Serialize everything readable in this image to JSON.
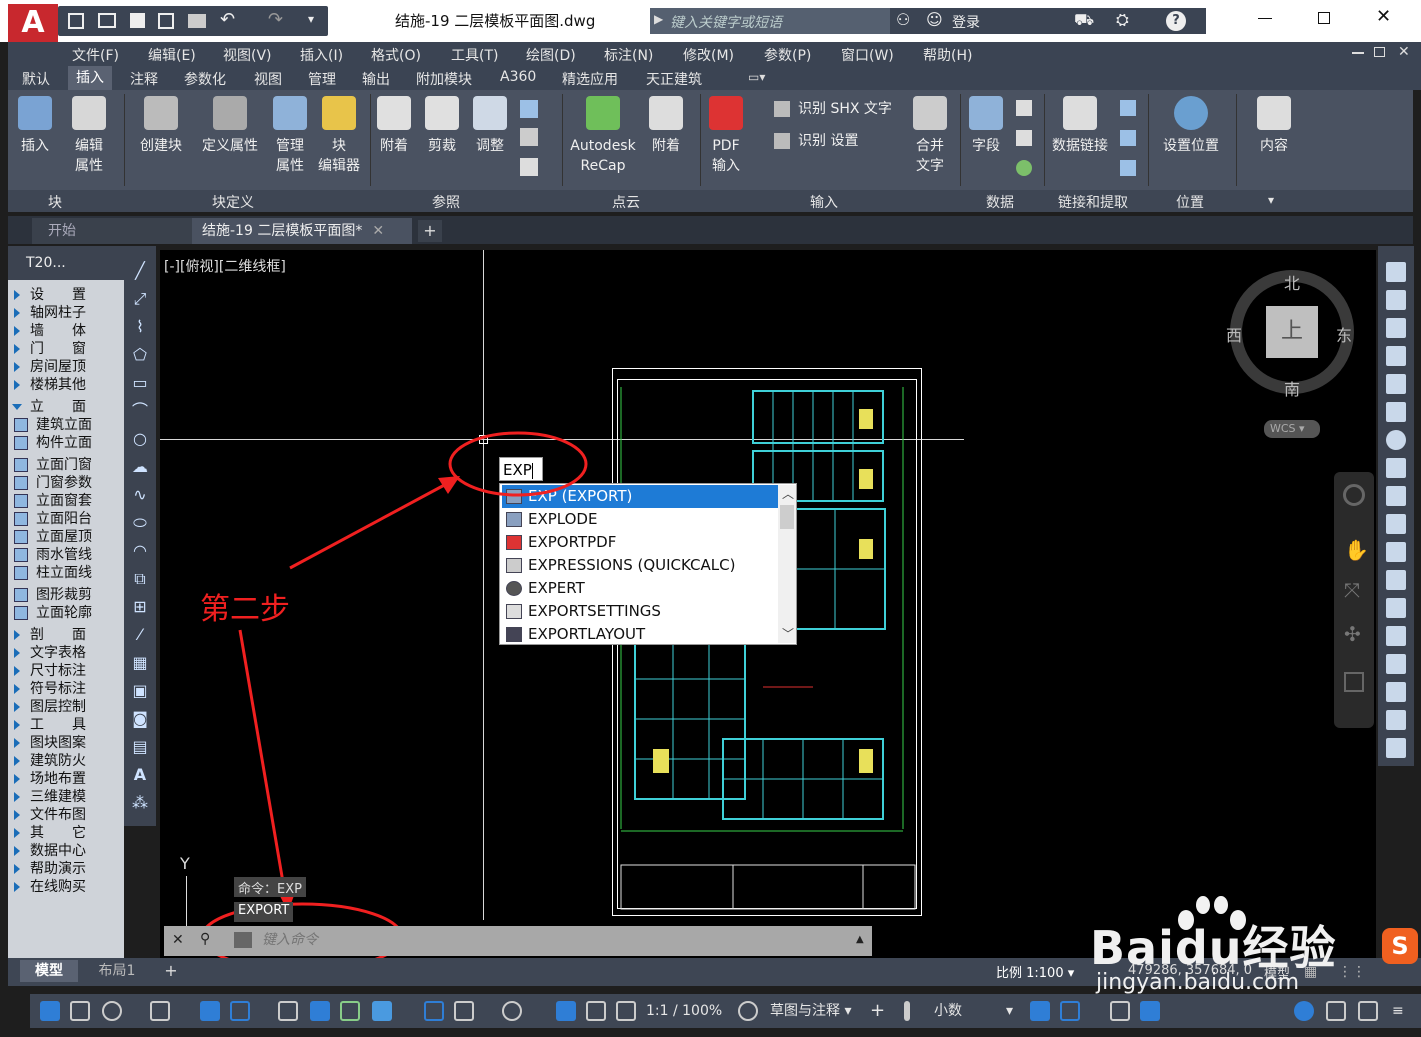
{
  "title": {
    "app_logo": "A",
    "file": "结施-19 二层模板平面图.dwg",
    "search_placeholder": "键入关键字或短语",
    "login": "登录"
  },
  "menu": [
    "文件(F)",
    "编辑(E)",
    "视图(V)",
    "插入(I)",
    "格式(O)",
    "工具(T)",
    "绘图(D)",
    "标注(N)",
    "修改(M)",
    "参数(P)",
    "窗口(W)",
    "帮助(H)"
  ],
  "ribbon_tabs": [
    "默认",
    "插入",
    "注释",
    "参数化",
    "视图",
    "管理",
    "输出",
    "附加模块",
    "A360",
    "精选应用",
    "天正建筑"
  ],
  "ribbon_active": "插入",
  "ribbon_buttons": {
    "insert": "插入",
    "edit_attr": "编辑",
    "edit_attr2": "属性",
    "create_block": "创建块",
    "define_attr": "定义属性",
    "manage_attr": "管理",
    "manage_attr2": "属性",
    "block_editor": "块",
    "block_editor2": "编辑器",
    "attach": "附着",
    "clip": "剪裁",
    "adjust": "调整",
    "recap": "Autodesk",
    "recap2": "ReCap",
    "attach2": "附着",
    "pdf": "PDF",
    "pdf2": "输入",
    "shx": "识别 SHX 文字",
    "shx_settings": "识别 设置",
    "merge": "合并",
    "merge2": "文字",
    "field": "字段",
    "data_link": "数据链接",
    "set_location": "设置位置",
    "content": "内容"
  },
  "panels": {
    "block": "块",
    "block_def": "块定义",
    "reference": "参照",
    "pointcloud": "点云",
    "import": "输入",
    "data": "数据",
    "link_extract": "链接和提取",
    "location": "位置"
  },
  "doc_tabs": {
    "start": "开始",
    "current": "结施-19 二层模板平面图*"
  },
  "t20": {
    "header": "T20...",
    "items": [
      {
        "l": "设　　置",
        "t": "tri"
      },
      {
        "l": "轴网柱子",
        "t": "tri"
      },
      {
        "l": "墙　　体",
        "t": "tri"
      },
      {
        "l": "门　　窗",
        "t": "tri"
      },
      {
        "l": "房间屋顶",
        "t": "tri"
      },
      {
        "l": "楼梯其他",
        "t": "tri"
      },
      {
        "l": "立　　面",
        "t": "open"
      },
      {
        "l": "建筑立面",
        "t": "sq"
      },
      {
        "l": "构件立面",
        "t": "sq"
      },
      {
        "l": "立面门窗",
        "t": "sq"
      },
      {
        "l": "门窗参数",
        "t": "sq"
      },
      {
        "l": "立面窗套",
        "t": "sq"
      },
      {
        "l": "立面阳台",
        "t": "sq"
      },
      {
        "l": "立面屋顶",
        "t": "sq"
      },
      {
        "l": "雨水管线",
        "t": "sq"
      },
      {
        "l": "柱立面线",
        "t": "sq"
      },
      {
        "l": "图形裁剪",
        "t": "sq"
      },
      {
        "l": "立面轮廓",
        "t": "sq"
      },
      {
        "l": "剖　　面",
        "t": "tri"
      },
      {
        "l": "文字表格",
        "t": "tri"
      },
      {
        "l": "尺寸标注",
        "t": "tri"
      },
      {
        "l": "符号标注",
        "t": "tri"
      },
      {
        "l": "图层控制",
        "t": "tri"
      },
      {
        "l": "工　　具",
        "t": "tri"
      },
      {
        "l": "图块图案",
        "t": "tri"
      },
      {
        "l": "建筑防火",
        "t": "tri"
      },
      {
        "l": "场地布置",
        "t": "tri"
      },
      {
        "l": "三维建模",
        "t": "tri"
      },
      {
        "l": "文件布图",
        "t": "tri"
      },
      {
        "l": "其　　它",
        "t": "tri"
      },
      {
        "l": "数据中心",
        "t": "tri"
      },
      {
        "l": "帮助演示",
        "t": "tri"
      },
      {
        "l": "在线购买",
        "t": "tri"
      }
    ]
  },
  "viewport": {
    "label": "[-][俯视][二维线框]",
    "compass": {
      "n": "北",
      "s": "南",
      "e": "东",
      "w": "西",
      "top": "上"
    },
    "wcs": "WCS"
  },
  "input": {
    "typed": "EXP"
  },
  "autocomplete": [
    "EXP (EXPORT)",
    "EXPLODE",
    "EXPORTPDF",
    "EXPRESSIONS (QUICKCALC)",
    "EXPERT",
    "EXPORTSETTINGS",
    "EXPORTLAYOUT"
  ],
  "annotation": "第二步",
  "history": {
    "line1": "命令：EXP",
    "line2": "EXPORT"
  },
  "cmd_placeholder": "键入命令",
  "axis_y": "Y",
  "status": {
    "model": "模型",
    "layout1": "布局1",
    "scale": "比例 1:100",
    "coords": "479286, 357684, 0",
    "model2": "模型"
  },
  "bottom": {
    "ratio": "1:1 / 100%",
    "workspace": "草图与注释",
    "units": "小数"
  },
  "watermark": {
    "text": "Baidu经验",
    "url": "jingyan.baidu.com"
  }
}
